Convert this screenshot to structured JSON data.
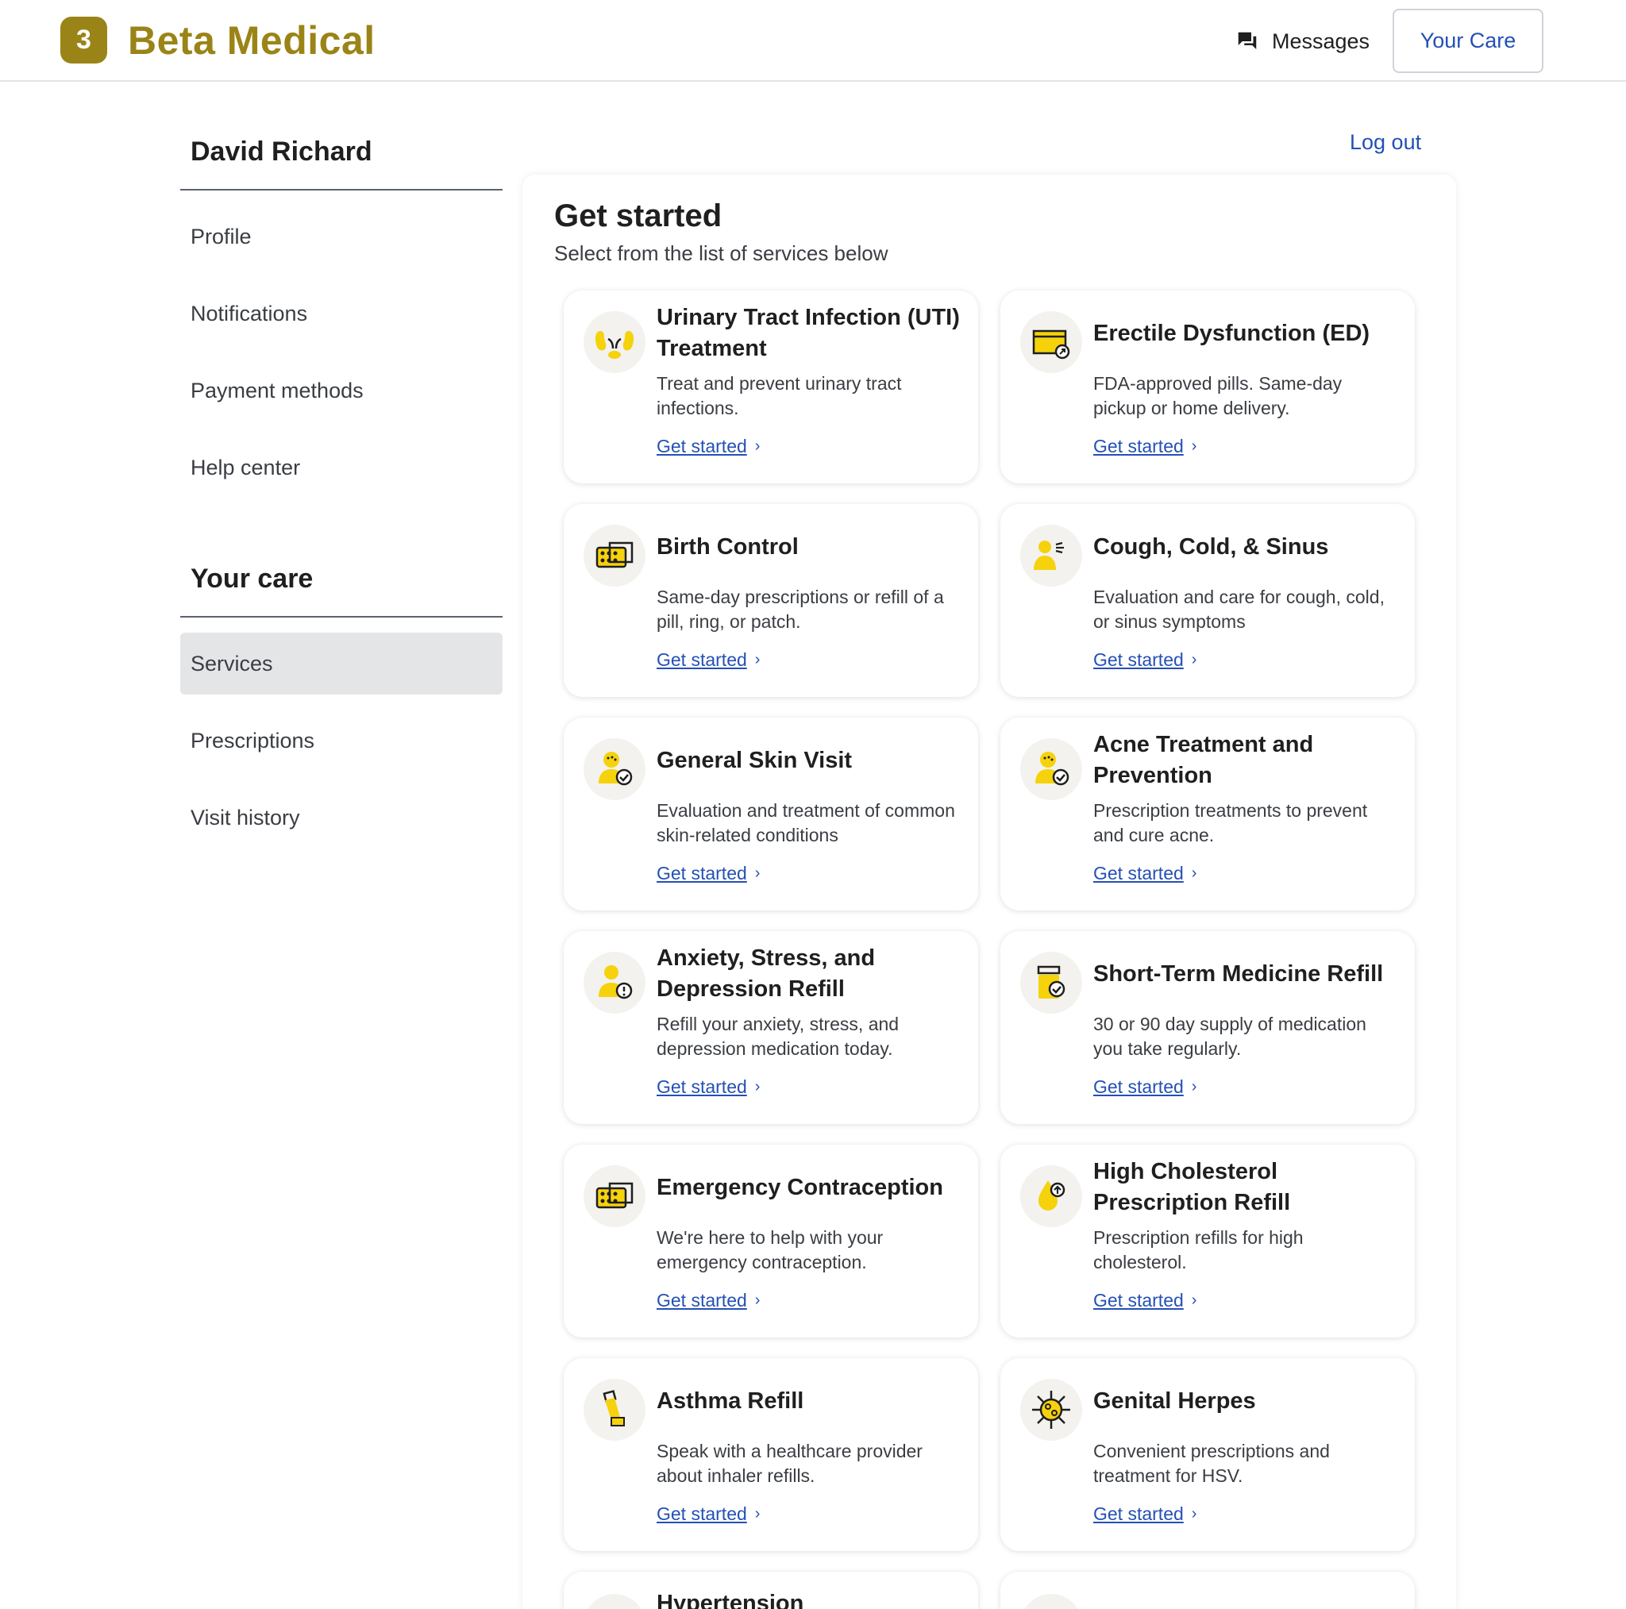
{
  "header": {
    "logo_glyph": "3",
    "brand": "Beta Medical",
    "messages_label": "Messages",
    "your_care_label": "Your Care",
    "brand_color": "#9a8417",
    "link_color": "#2450b5"
  },
  "sidebar": {
    "user_name": "David Richard",
    "account_items": [
      {
        "label": "Profile"
      },
      {
        "label": "Notifications"
      },
      {
        "label": "Payment methods"
      },
      {
        "label": "Help center"
      }
    ],
    "care_heading": "Your care",
    "care_items": [
      {
        "label": "Services",
        "active": true
      },
      {
        "label": "Prescriptions"
      },
      {
        "label": "Visit history"
      }
    ]
  },
  "logout_label": "Log out",
  "main": {
    "title": "Get started",
    "subtitle": "Select from the list of services below",
    "link_label": "Get started",
    "services": [
      {
        "title": "Urinary Tract Infection (UTI) Treatment",
        "desc": "Treat and prevent urinary tract infections.",
        "icon": "kidney-icon"
      },
      {
        "title": "Erectile Dysfunction (ED)",
        "desc": "FDA-approved pills. Same-day pickup or home delivery.",
        "icon": "pill-box-icon"
      },
      {
        "title": "Birth Control",
        "desc": "Same-day prescriptions or refill of a pill, ring, or patch.",
        "icon": "pill-pack-icon"
      },
      {
        "title": "Cough, Cold, & Sinus",
        "desc": "Evaluation and care for cough, cold, or sinus symptoms",
        "icon": "cough-person-icon"
      },
      {
        "title": "General Skin Visit",
        "desc": "Evaluation and treatment of common skin-related conditions",
        "icon": "skin-check-icon"
      },
      {
        "title": "Acne Treatment and Prevention",
        "desc": "Prescription treatments to prevent and cure acne.",
        "icon": "acne-check-icon"
      },
      {
        "title": "Anxiety, Stress, and Depression Refill",
        "desc": "Refill your anxiety, stress, and depression medication today.",
        "icon": "person-alert-icon"
      },
      {
        "title": "Short-Term Medicine Refill",
        "desc": "30 or 90 day supply of medication you take regularly.",
        "icon": "pill-bottle-icon"
      },
      {
        "title": "Emergency Contraception",
        "desc": "We're here to help with your emergency contraception.",
        "icon": "pill-pack-icon"
      },
      {
        "title": "High Cholesterol Prescription Refill",
        "desc": "Prescription refills for high cholesterol.",
        "icon": "droplet-up-icon"
      },
      {
        "title": "Asthma Refill",
        "desc": "Speak with a healthcare provider about inhaler refills.",
        "icon": "inhaler-icon"
      },
      {
        "title": "Genital Herpes",
        "desc": "Convenient prescriptions and treatment for HSV.",
        "icon": "virus-icon"
      }
    ],
    "partial_services": [
      {
        "title": "Hypertension"
      },
      {
        "title": ""
      }
    ]
  }
}
